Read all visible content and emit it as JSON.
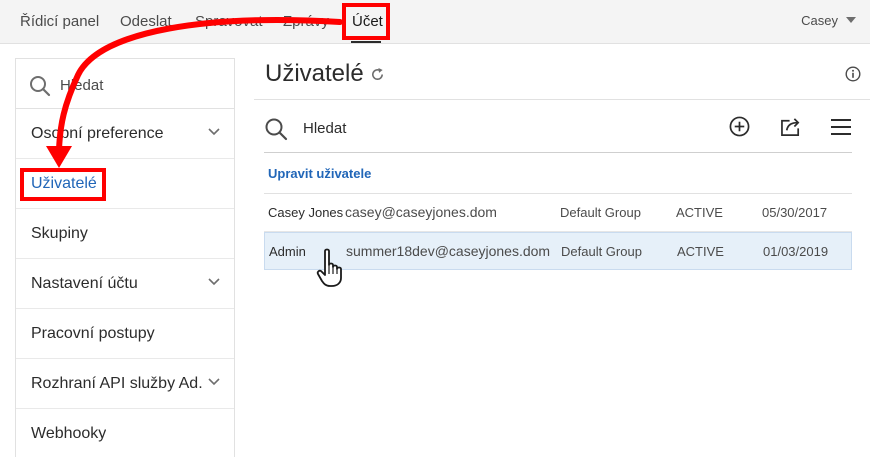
{
  "topnav": {
    "items": [
      {
        "label": "Řídicí panel"
      },
      {
        "label": "Odeslat"
      },
      {
        "label": "Spravovat"
      },
      {
        "label": "Zprávy"
      },
      {
        "label": "Účet"
      }
    ],
    "active_index": 4,
    "user_name": "Casey"
  },
  "sidebar": {
    "search_placeholder": "Hledat",
    "items": [
      {
        "label": "Osobní preference",
        "has_chevron": true
      },
      {
        "label": "Uživatelé",
        "selected": true
      },
      {
        "label": "Skupiny"
      },
      {
        "label": "Nastavení účtu",
        "has_chevron": true
      },
      {
        "label": "Pracovní postupy"
      },
      {
        "label": "Rozhraní API služby Ad...",
        "has_chevron": true
      },
      {
        "label": "Webhooky"
      }
    ]
  },
  "main": {
    "title": "Uživatelé",
    "search_placeholder": "Hledat",
    "edit_users_label": "Upravit uživatele",
    "rows": [
      {
        "name": "Casey Jones",
        "email": "casey@caseyjones.dom",
        "group": "Default Group",
        "status": "ACTIVE",
        "date": "05/30/2017"
      },
      {
        "name": "Admin",
        "email": "summer18dev@caseyjones.dom",
        "group": "Default Group",
        "status": "ACTIVE",
        "date": "01/03/2019"
      }
    ],
    "hovered_row_index": 1
  },
  "colors": {
    "accent_blue": "#2166b8",
    "annotation_red": "#ff0000",
    "hover_row": "#e6f0f9"
  },
  "icons": [
    "search-icon",
    "chevron-down-icon",
    "refresh-icon",
    "info-icon",
    "add-icon",
    "share-icon",
    "menu-icon",
    "hand-cursor-icon",
    "caret-down-icon"
  ]
}
